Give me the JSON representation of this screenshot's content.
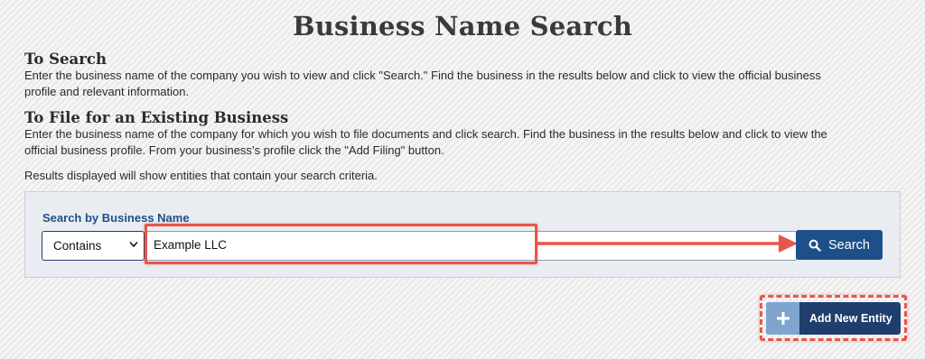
{
  "page": {
    "title": "Business Name Search"
  },
  "sections": [
    {
      "heading": "To Search",
      "lines": [
        "Enter the business name of the company you wish to view and click \"Search.\" Find the business in the results below and click to view the official business",
        "profile and relevant information."
      ]
    },
    {
      "heading": "To File for an Existing Business",
      "lines": [
        "Enter the business name of the company for which you wish to file documents and click search. Find the business in the results below and click to view the",
        "official business profile. From your business’s profile click the \"Add Filing\" button."
      ]
    }
  ],
  "note": "Results displayed will show entities that contain your search criteria.",
  "search": {
    "label": "Search by Business Name",
    "mode_selected": "Contains",
    "query_value": "Example LLC",
    "button_label": "Search",
    "button_icon": "search-icon"
  },
  "actions": {
    "add_entity_label": "Add New Entity",
    "add_entity_icon": "plus-icon"
  },
  "colors": {
    "primary": "#1f4f8a",
    "dark_button": "#1f3e6d",
    "icon_tile": "#7fa5cf",
    "annotation": "#e8554a",
    "panel_bg": "#e9edf2"
  }
}
